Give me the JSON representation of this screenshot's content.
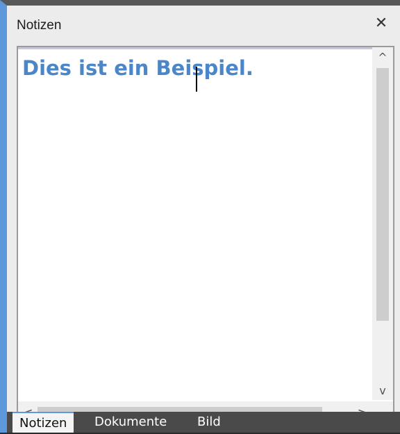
{
  "window": {
    "title": "Notizen",
    "close_glyph": "✕"
  },
  "editor": {
    "content": "Dies ist ein Beispiel.",
    "text_color": "#4a86c8"
  },
  "scrollbars": {
    "up_glyph": "^",
    "down_glyph": "v",
    "left_glyph": "<",
    "right_glyph": ">"
  },
  "tabs": [
    {
      "label": "Notizen",
      "active": true
    },
    {
      "label": "Dokumente",
      "active": false
    },
    {
      "label": "Bild",
      "active": false
    }
  ],
  "colors": {
    "accent": "#5f97db",
    "tab_strip": "#4a4a4a"
  }
}
